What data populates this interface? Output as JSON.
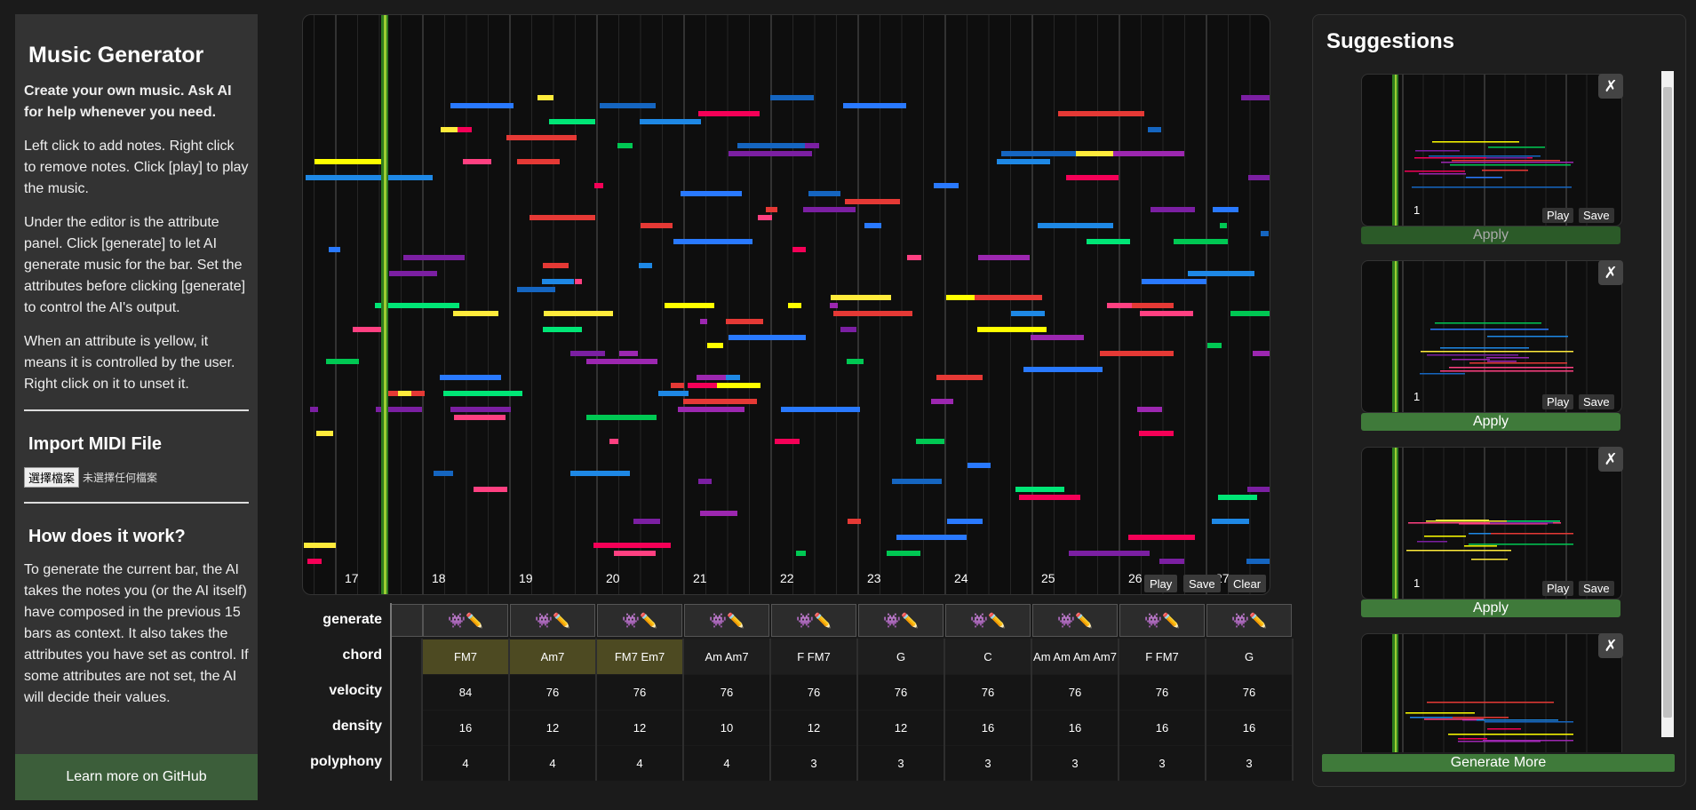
{
  "sidebar": {
    "title": "Music Generator",
    "intro": "Create your own music. Ask AI for help whenever you need.",
    "p1": "Left click to add notes. Right click to remove notes. Click [play] to play the music.",
    "p2": "Under the editor is the attribute panel. Click [generate] to let AI generate music for the bar. Set the attributes before clicking [generate] to control the AI's output.",
    "p3": "When an attribute is yellow, it means it is controlled by the user. Right click on it to unset it.",
    "import_title": "Import MIDI File",
    "file_button": "選擇檔案",
    "file_status": "未選擇任何檔案",
    "how_title": "How does it work?",
    "how_text": "To generate the current bar, the AI takes the notes you (or the AI itself) have composed in the previous 15 bars as context. It also takes the attributes you have set as control. If some attributes are not set, the AI will decide their values.",
    "github": "Learn more on GitHub"
  },
  "roll": {
    "bar_numbers": [
      "17",
      "18",
      "19",
      "20",
      "21",
      "22",
      "23",
      "24",
      "25",
      "26",
      "27"
    ],
    "play": "Play",
    "save": "Save",
    "clear": "Clear",
    "colors": [
      "#1565c0",
      "#e53935",
      "#7b1fa2",
      "#ffeb3b",
      "#00c853",
      "#ff4081",
      "#00e676",
      "#f50057",
      "#2979ff",
      "#9c27b0",
      "#ffff00",
      "#1e88e5"
    ]
  },
  "attributes": {
    "labels": {
      "generate": "generate",
      "chord": "chord",
      "velocity": "velocity",
      "density": "density",
      "polyphony": "polyphony"
    },
    "gen_icons": "👾✏️",
    "columns": [
      {
        "chord": "FM7",
        "velocity": "84",
        "density": "16",
        "polyphony": "4",
        "user": true
      },
      {
        "chord": "Am7",
        "velocity": "76",
        "density": "12",
        "polyphony": "4",
        "user": true
      },
      {
        "chord": "FM7 Em7",
        "velocity": "76",
        "density": "12",
        "polyphony": "4",
        "user": true
      },
      {
        "chord": "Am Am7",
        "velocity": "76",
        "density": "10",
        "polyphony": "4",
        "user": false
      },
      {
        "chord": "F FM7",
        "velocity": "76",
        "density": "12",
        "polyphony": "3",
        "user": false
      },
      {
        "chord": "G",
        "velocity": "76",
        "density": "12",
        "polyphony": "3",
        "user": false
      },
      {
        "chord": "C",
        "velocity": "76",
        "density": "16",
        "polyphony": "3",
        "user": false
      },
      {
        "chord": "Am Am Am Am7",
        "velocity": "76",
        "density": "16",
        "polyphony": "3",
        "user": false
      },
      {
        "chord": "F FM7",
        "velocity": "76",
        "density": "16",
        "polyphony": "3",
        "user": false
      },
      {
        "chord": "G",
        "velocity": "76",
        "density": "16",
        "polyphony": "3",
        "user": false
      }
    ]
  },
  "suggestions": {
    "title": "Suggestions",
    "close_icon": "✗",
    "apply": "Apply",
    "play": "Play",
    "save": "Save",
    "bar_label": "1",
    "generate_more": "Generate More"
  }
}
